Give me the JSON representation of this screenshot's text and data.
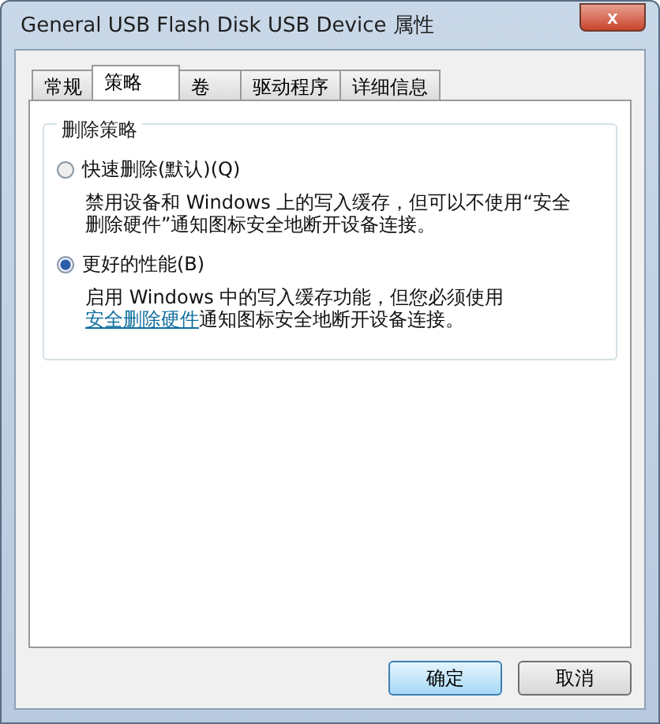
{
  "window": {
    "title": "General USB Flash Disk USB Device 属性",
    "close": "x"
  },
  "tabs": [
    {
      "label": "常规",
      "selected": false
    },
    {
      "label": "策略",
      "selected": true
    },
    {
      "label": "卷",
      "selected": false
    },
    {
      "label": "驱动程序",
      "selected": false
    },
    {
      "label": "详细信息",
      "selected": false
    }
  ],
  "group": {
    "title": "删除策略",
    "options": [
      {
        "label": "快速删除(默认)(Q)",
        "selected": false,
        "description": "禁用设备和 Windows 上的写入缓存，但可以不使用“安全删除硬件”通知图标安全地断开设备连接。"
      },
      {
        "label": "更好的性能(B)",
        "selected": true,
        "description": "启用 Windows 中的写入缓存功能，但您必须使用",
        "link": "安全删除硬件",
        "description_after": "通知图标安全地断开设备连接。"
      }
    ]
  },
  "buttons": [
    {
      "label": "确定",
      "default": true
    },
    {
      "label": "取消",
      "default": false
    }
  ]
}
